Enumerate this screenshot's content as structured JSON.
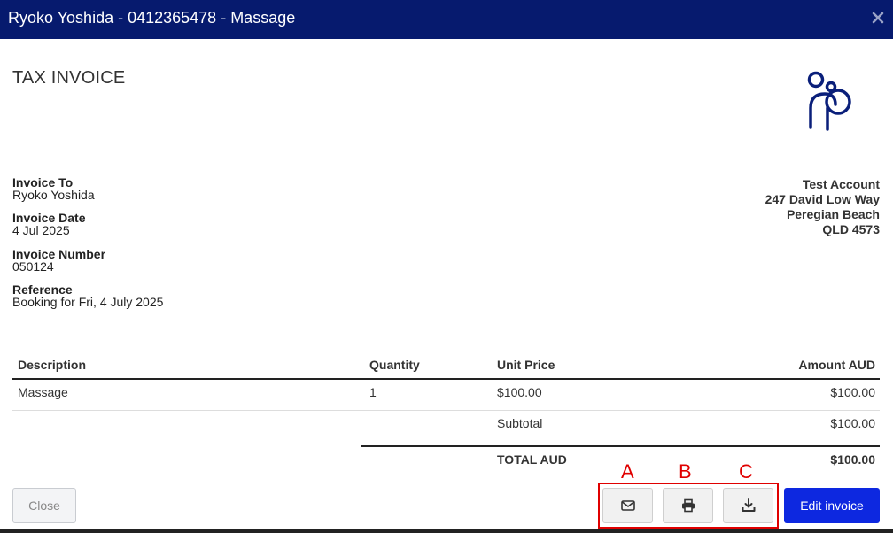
{
  "modal": {
    "title": "Ryoko Yoshida - 0412365478 - Massage",
    "close_icon": "close-icon"
  },
  "invoice": {
    "document_title": "TAX INVOICE",
    "invoice_to_label": "Invoice To",
    "invoice_to_value": "Ryoko Yoshida",
    "invoice_date_label": "Invoice Date",
    "invoice_date_value": "4 Jul 2025",
    "invoice_number_label": "Invoice Number",
    "invoice_number_value": "050124",
    "reference_label": "Reference",
    "reference_value": "Booking for Fri, 4 July 2025"
  },
  "business": {
    "name": "Test Account",
    "street": "247 David Low Way",
    "suburb": "Peregian Beach",
    "state_postcode": "QLD 4573",
    "logo_icon": "rp-logo",
    "brand_color": "#0a1f7a"
  },
  "table": {
    "headers": {
      "description": "Description",
      "quantity": "Quantity",
      "unit_price": "Unit Price",
      "amount": "Amount AUD"
    },
    "rows": [
      {
        "description": "Massage",
        "quantity": "1",
        "unit_price": "$100.00",
        "amount": "$100.00"
      }
    ],
    "subtotal_label": "Subtotal",
    "subtotal_value": "$100.00",
    "total_label": "TOTAL AUD",
    "total_value": "$100.00"
  },
  "footer": {
    "close_label": "Close",
    "email_icon": "email-icon",
    "print_icon": "print-icon",
    "download_icon": "download-icon",
    "edit_label": "Edit invoice",
    "edit_color": "#0d28e0"
  },
  "annotations": {
    "marker_a": "A",
    "marker_b": "B",
    "marker_c": "C",
    "highlight_color": "#e00000"
  }
}
